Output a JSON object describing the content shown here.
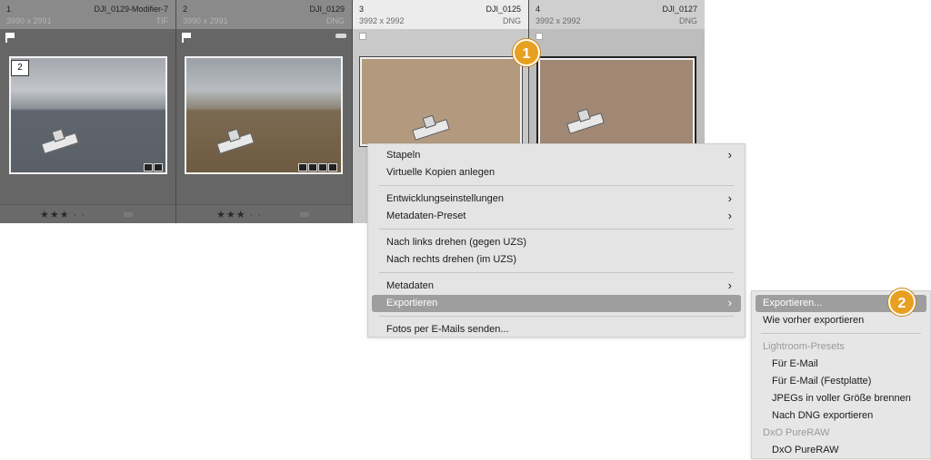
{
  "grid": {
    "cells": [
      {
        "index": "1",
        "name": "DJI_0129-Modifier-7",
        "dims": "3990 x 2991",
        "type": "TIF",
        "stack_count": "2",
        "rating": "★★★ · ·"
      },
      {
        "index": "2",
        "name": "DJI_0129",
        "dims": "3990 x 2991",
        "type": "DNG",
        "rating": "★★★ · ·"
      },
      {
        "index": "3",
        "name": "DJI_0125",
        "dims": "3992 x 2992",
        "type": "DNG"
      },
      {
        "index": "4",
        "name": "DJI_0127",
        "dims": "3992 x 2992",
        "type": "DNG"
      }
    ]
  },
  "context_menu": {
    "items": [
      {
        "label": "Stapeln",
        "submenu": true
      },
      {
        "label": "Virtuelle Kopien anlegen",
        "submenu": false
      },
      {
        "label": "Entwicklungseinstellungen",
        "submenu": true
      },
      {
        "label": "Metadaten-Preset",
        "submenu": true
      },
      {
        "label": "Nach links drehen (gegen UZS)",
        "submenu": false
      },
      {
        "label": "Nach rechts drehen (im UZS)",
        "submenu": false
      },
      {
        "label": "Metadaten",
        "submenu": true
      },
      {
        "label": "Exportieren",
        "submenu": true,
        "active": true
      },
      {
        "label": "Fotos per E-Mails senden...",
        "submenu": false
      }
    ],
    "arrow_glyph": "›"
  },
  "export_submenu": {
    "items": [
      {
        "label": "Exportieren...",
        "active": true
      },
      {
        "label": "Wie vorher exportieren"
      },
      {
        "label": "Lightroom-Presets",
        "header": true
      },
      {
        "label": "Für E-Mail"
      },
      {
        "label": "Für E-Mail (Festplatte)"
      },
      {
        "label": "JPEGs in voller Größe brennen"
      },
      {
        "label": "Nach DNG exportieren"
      },
      {
        "label": "DxO PureRAW",
        "header": true
      },
      {
        "label": "DxO PureRAW"
      }
    ]
  },
  "callouts": [
    "1",
    "2"
  ],
  "colors": {
    "callout": "#e8a020",
    "menu_active": "#9e9e9e"
  }
}
